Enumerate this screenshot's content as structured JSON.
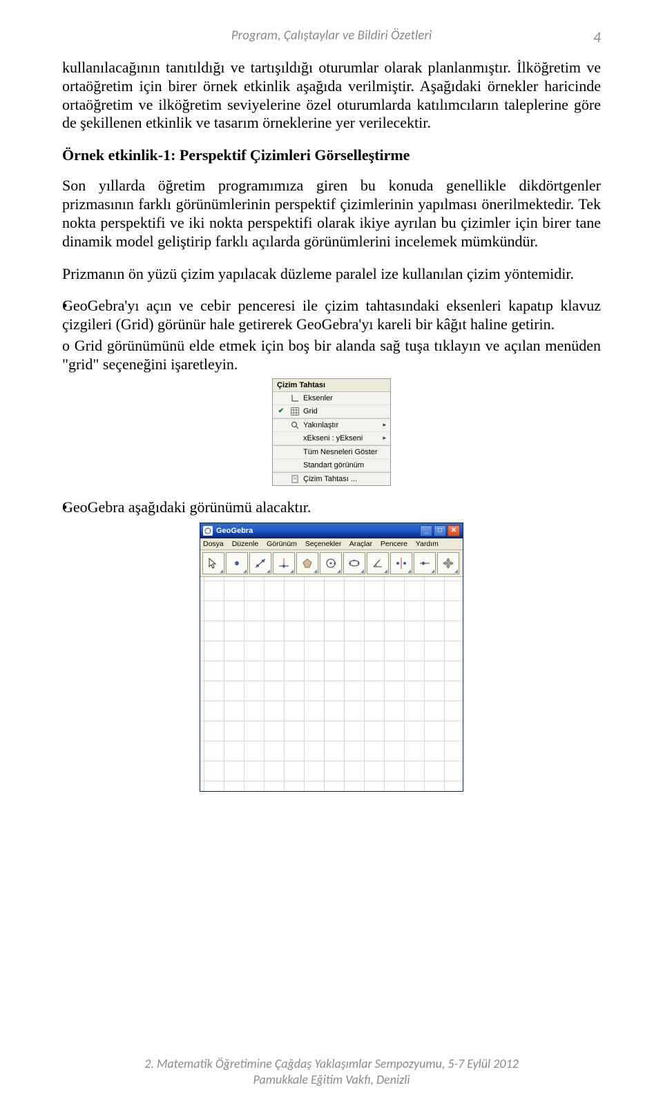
{
  "header": {
    "running_title": "Program, Çalıştaylar ve Bildiri Özetleri",
    "page_number": "4"
  },
  "paragraphs": {
    "p1": "kullanılacağının tanıtıldığı ve tartışıldığı oturumlar olarak planlanmıştır. İlköğretim ve ortaöğretim için birer örnek etkinlik aşağıda verilmiştir. Aşağıdaki örnekler haricinde ortaöğretim ve ilköğretim seviyelerine özel oturumlarda katılımcıların taleplerine göre de şekillenen etkinlik ve tasarım örneklerine yer verilecektir.",
    "heading1": "Örnek etkinlik-1: Perspektif Çizimleri Görselleştirme",
    "p2": "Son yıllarda öğretim programımıza giren bu konuda genellikle dikdörtgenler prizmasının farklı görünümlerinin perspektif çizimlerinin yapılması önerilmektedir. Tek nokta perspektifi ve iki nokta perspektifi olarak ikiye ayrılan bu çizimler için birer tane dinamik model geliştirip farklı açılarda görünümlerini incelemek mümkündür.",
    "p3": "Prizmanın ön yüzü çizim yapılacak düzleme paralel ize kullanılan çizim yöntemidir.",
    "li1": "GeoGebra'yı açın ve cebir penceresi ile çizim tahtasındaki eksenleri kapatıp klavuz çizgileri (Grid) görünür hale getirerek GeoGebra'yı kareli bir kâğıt haline getirin.",
    "li1a": "Grid görünümünü elde etmek için boş bir alanda sağ tuşa tıklayın ve açılan menüden \"grid\" seçeneğini işaretleyin.",
    "li2": "GeoGebra aşağıdaki görünümü alacaktır."
  },
  "context_menu": {
    "title": "Çizim Tahtası",
    "items": [
      {
        "label": "Eksenler",
        "icon": "axes"
      },
      {
        "label": "Grid",
        "icon": "grid",
        "checked": true
      },
      {
        "label": "Yakınlaştır",
        "icon": "magnifier",
        "submenu": true
      },
      {
        "label": "xEkseni : yEkseni",
        "icon": "",
        "submenu": true
      },
      {
        "label": "Tüm Nesneleri Göster",
        "icon": ""
      },
      {
        "label": "Standart görünüm",
        "icon": ""
      },
      {
        "label": "Çizim Tahtası ...",
        "icon": "doc"
      }
    ]
  },
  "geogebra_window": {
    "title": "GeoGebra",
    "menubar": [
      "Dosya",
      "Düzenle",
      "Görünüm",
      "Seçenekler",
      "Araçlar",
      "Pencere",
      "Yardım"
    ],
    "tools": [
      "move",
      "point",
      "line",
      "perpendicular",
      "polygon",
      "circle",
      "conic",
      "angle",
      "reflect",
      "slider",
      "text"
    ]
  },
  "footer": {
    "line1": "2. Matematik Öğretimine Çağdaş Yaklaşımlar Sempozyumu, 5-7 Eylül 2012",
    "line2": "Pamukkale Eğitim Vakfı, Denizli"
  }
}
